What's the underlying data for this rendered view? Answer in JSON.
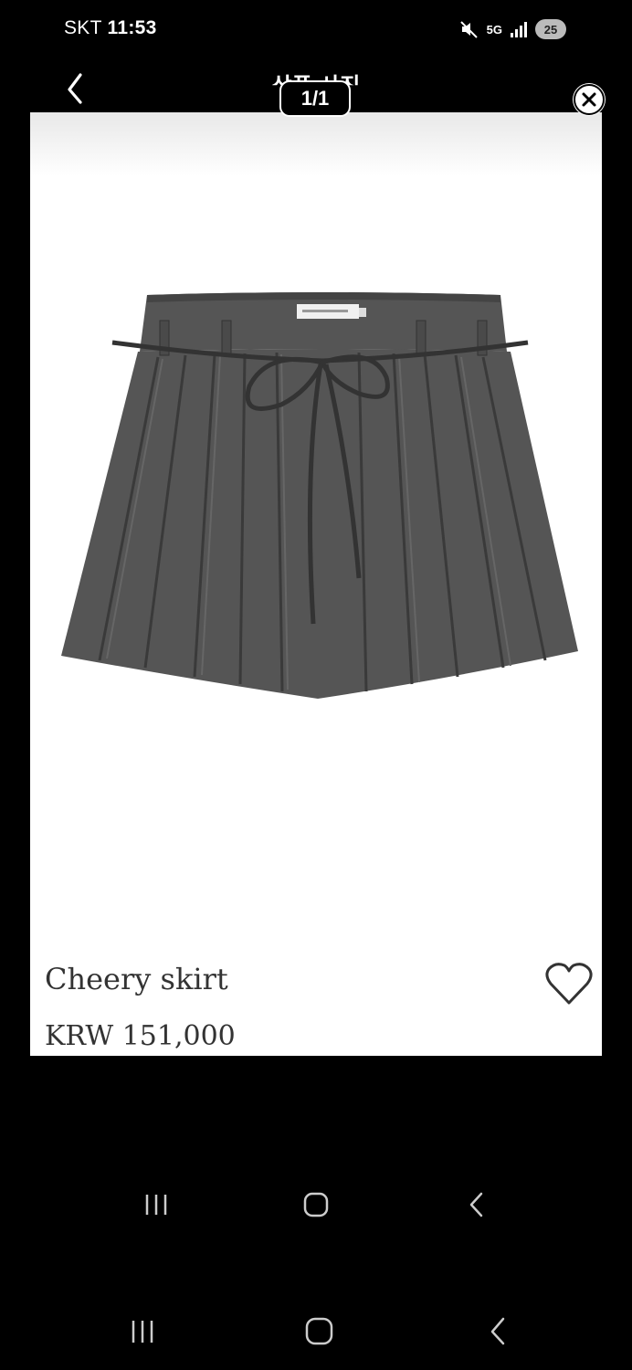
{
  "status_bar": {
    "carrier": "SKT",
    "time": "11:53",
    "network": "5G",
    "battery": "25"
  },
  "header": {
    "title": "상품 사진",
    "counter": "1/1"
  },
  "product": {
    "name": "Cheery skirt",
    "price": "KRW 151,000"
  },
  "icons": {
    "back": "chevron-left-icon",
    "close": "close-circle-icon",
    "wishlist": "heart-outline-icon",
    "mute": "mute-icon",
    "signal": "signal-bars-icon",
    "recents": "recents-icon",
    "home": "home-icon",
    "nav_back": "back-icon"
  }
}
